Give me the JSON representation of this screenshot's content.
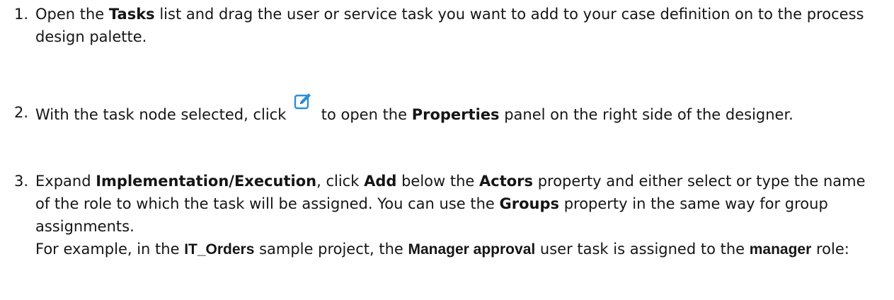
{
  "steps": [
    {
      "num": "1.",
      "t1": "Open the ",
      "b1": "Tasks",
      "t2": " list and drag the user or service task you want to add to your case definition on to the process design palette."
    },
    {
      "num": "2.",
      "t1": "With the task node selected, click ",
      "icon": "edit-icon",
      "t2": " to open the ",
      "b1": "Properties",
      "t3": " panel on the right side of the designer."
    },
    {
      "num": "3.",
      "t1": "Expand ",
      "b1": "Implementation/Execution",
      "t2": ", click ",
      "b2": "Add",
      "t3": " below the ",
      "b3": "Actors",
      "t4": " property and either select or type the name of the role to which the task will be assigned. You can use the ",
      "b4": "Groups",
      "t5": " property in the same way for group assignments.",
      "e1": "For example, in the ",
      "eb1": "IT_Orders",
      "e2": " sample project, the ",
      "eb2": "Manager approval",
      "e3": " user task is assigned to the ",
      "eb3": "manager",
      "e4": " role:"
    }
  ],
  "colors": {
    "text": "#151515",
    "icon": "#2a8fd6"
  }
}
